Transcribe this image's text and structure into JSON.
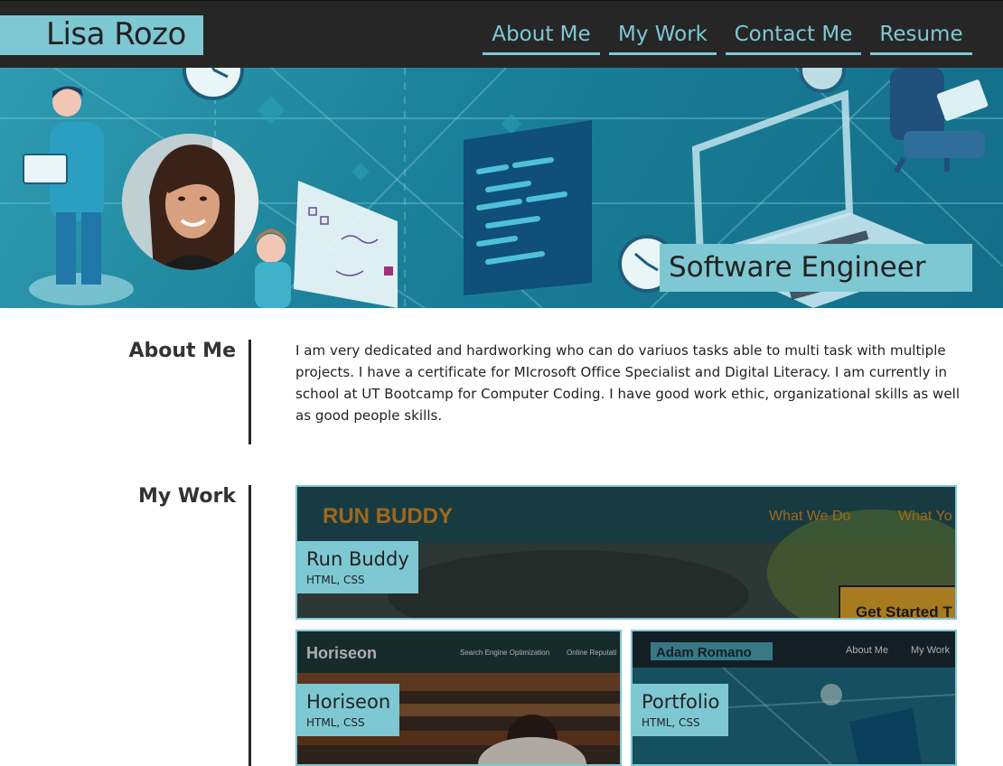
{
  "header": {
    "brand": "Lisa Rozo",
    "nav": [
      {
        "label": "About Me"
      },
      {
        "label": "My Work"
      },
      {
        "label": "Contact Me"
      },
      {
        "label": "Resume"
      }
    ]
  },
  "hero": {
    "tagline": "Software Engineer",
    "illustration_icons": [
      "person-with-laptop",
      "clock",
      "code-window",
      "laptop",
      "whiteboard",
      "person-on-chair"
    ]
  },
  "about": {
    "title": "About Me",
    "text": "I am very dedicated and hardworking who can do variuos tasks able to multi task with multiple projects. I have a certificate for MIcrosoft Office Specialist and Digital Literacy. I am currently in school at UT Bootcamp for Computer Coding. I have good work ethic, organizational skills as well as good people skills."
  },
  "work": {
    "title": "My Work",
    "projects": [
      {
        "name": "Run Buddy",
        "tech": "HTML, CSS",
        "preview": {
          "logo": "RUN BUDDY",
          "nav": [
            "What We Do",
            "What Yo"
          ],
          "cta": "Get Started T"
        }
      },
      {
        "name": "Horiseon",
        "tech": "HTML, CSS",
        "preview": {
          "logo": "Horiseon",
          "nav": [
            "Search Engine Optimization",
            "Online Reputati"
          ]
        }
      },
      {
        "name": "Portfolio",
        "tech": "HTML, CSS",
        "preview": {
          "logo": "Adam Romano",
          "nav": [
            "About Me",
            "My Work"
          ]
        }
      }
    ]
  },
  "colors": {
    "accent": "#7ec8d3",
    "header_bg": "#262626",
    "hero_bg": "#1a7f98",
    "divider": "#262626"
  }
}
